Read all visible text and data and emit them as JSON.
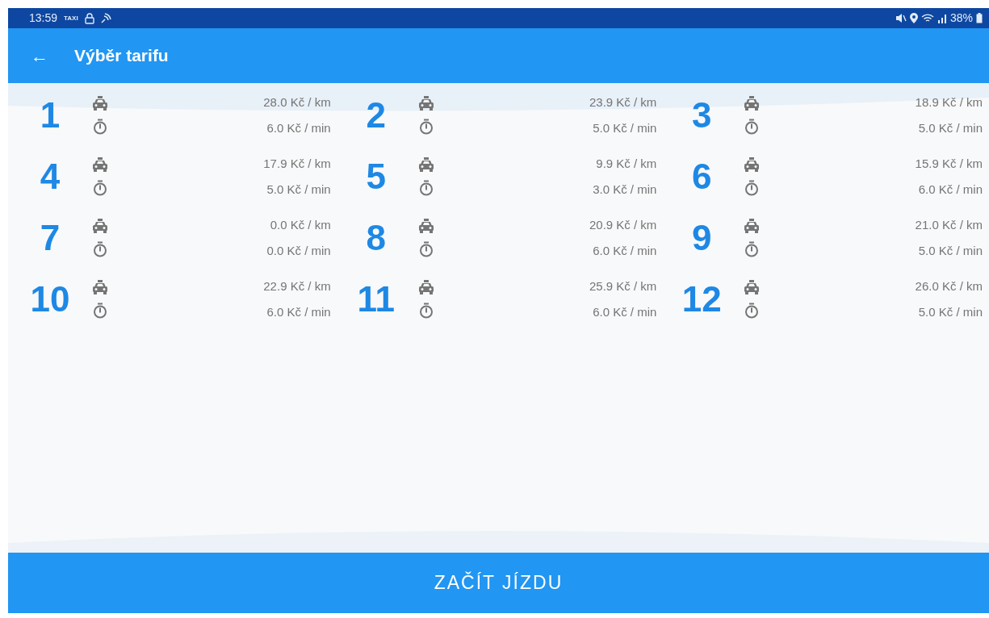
{
  "status_bar": {
    "time": "13:59",
    "taxi_label": "TAXI",
    "battery": "38%"
  },
  "app_bar": {
    "back": "←",
    "title": "Výběr tarifu"
  },
  "tariffs": [
    {
      "number": "1",
      "per_km": "28.0 Kč / km",
      "per_min": "6.0 Kč / min"
    },
    {
      "number": "2",
      "per_km": "23.9 Kč / km",
      "per_min": "5.0 Kč / min"
    },
    {
      "number": "3",
      "per_km": "18.9 Kč / km",
      "per_min": "5.0 Kč / min"
    },
    {
      "number": "4",
      "per_km": "17.9 Kč / km",
      "per_min": "5.0 Kč / min"
    },
    {
      "number": "5",
      "per_km": "9.9 Kč / km",
      "per_min": "3.0 Kč / min"
    },
    {
      "number": "6",
      "per_km": "15.9 Kč / km",
      "per_min": "6.0 Kč / min"
    },
    {
      "number": "7",
      "per_km": "0.0 Kč / km",
      "per_min": "0.0 Kč / min"
    },
    {
      "number": "8",
      "per_km": "20.9 Kč / km",
      "per_min": "6.0 Kč / min"
    },
    {
      "number": "9",
      "per_km": "21.0 Kč / km",
      "per_min": "5.0 Kč / min"
    },
    {
      "number": "10",
      "per_km": "22.9 Kč / km",
      "per_min": "6.0 Kč / min"
    },
    {
      "number": "11",
      "per_km": "25.9 Kč / km",
      "per_min": "6.0 Kč / min"
    },
    {
      "number": "12",
      "per_km": "26.0 Kč / km",
      "per_min": "5.0 Kč / min"
    }
  ],
  "start_button": "ZAČÍT JÍZDU"
}
